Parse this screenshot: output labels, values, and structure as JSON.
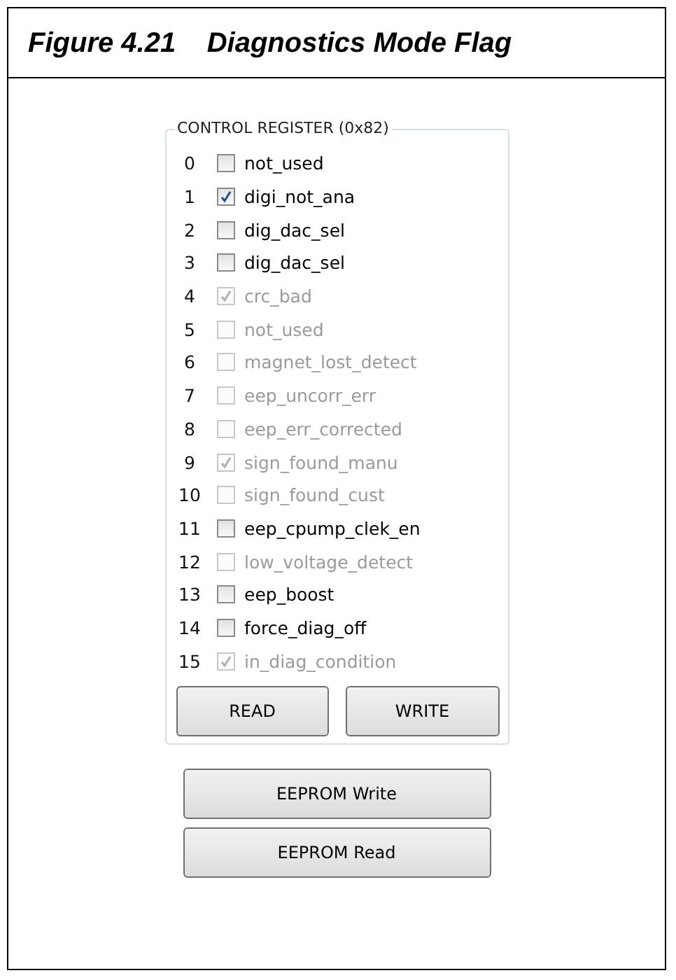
{
  "figure": {
    "title": "Figure 4.21    Diagnostics Mode Flag"
  },
  "group": {
    "title": "CONTROL REGISTER (0x82)"
  },
  "bits": [
    {
      "index": "0",
      "label": "not_used",
      "checked": false,
      "disabled": false
    },
    {
      "index": "1",
      "label": "digi_not_ana",
      "checked": true,
      "disabled": false
    },
    {
      "index": "2",
      "label": "dig_dac_sel",
      "checked": false,
      "disabled": false
    },
    {
      "index": "3",
      "label": "dig_dac_sel",
      "checked": false,
      "disabled": false
    },
    {
      "index": "4",
      "label": "crc_bad",
      "checked": true,
      "disabled": true
    },
    {
      "index": "5",
      "label": "not_used",
      "checked": false,
      "disabled": true
    },
    {
      "index": "6",
      "label": "magnet_lost_detect",
      "checked": false,
      "disabled": true
    },
    {
      "index": "7",
      "label": "eep_uncorr_err",
      "checked": false,
      "disabled": true
    },
    {
      "index": "8",
      "label": "eep_err_corrected",
      "checked": false,
      "disabled": true
    },
    {
      "index": "9",
      "label": "sign_found_manu",
      "checked": true,
      "disabled": true
    },
    {
      "index": "10",
      "label": "sign_found_cust",
      "checked": false,
      "disabled": true
    },
    {
      "index": "11",
      "label": "eep_cpump_clek_en",
      "checked": false,
      "disabled": false
    },
    {
      "index": "12",
      "label": "low_voltage_detect",
      "checked": false,
      "disabled": true
    },
    {
      "index": "13",
      "label": "eep_boost",
      "checked": false,
      "disabled": false
    },
    {
      "index": "14",
      "label": "force_diag_off",
      "checked": false,
      "disabled": false
    },
    {
      "index": "15",
      "label": "in_diag_condition",
      "checked": true,
      "disabled": true
    }
  ],
  "group_buttons": [
    "READ",
    "WRITE"
  ],
  "buttons": [
    "EEPROM Write",
    "EEPROM Read"
  ]
}
